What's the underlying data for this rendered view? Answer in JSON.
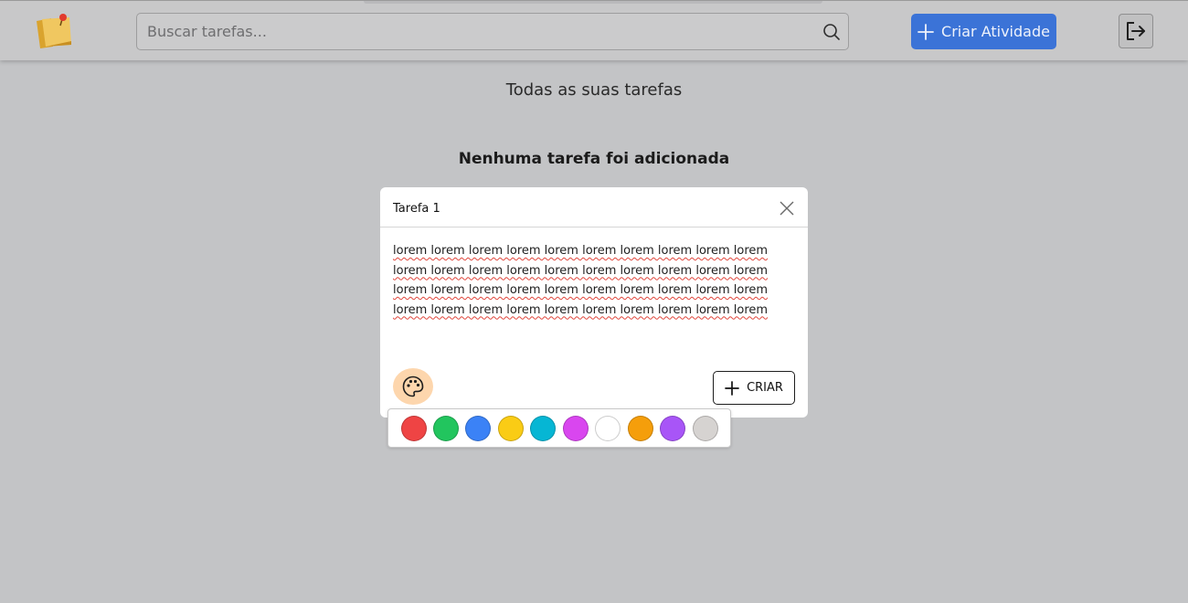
{
  "header": {
    "search_placeholder": "Buscar tarefas...",
    "search_value": "",
    "create_label": "Criar Atividade",
    "logo_icon": "sticky-note-pin-icon",
    "search_icon": "search-icon",
    "create_icon": "plus-icon",
    "logout_icon": "logout-icon"
  },
  "main": {
    "subtitle": "Todas as suas tarefas",
    "empty_message": "Nenhuma tarefa foi adicionada"
  },
  "modal": {
    "title_value": "Tarefa 1",
    "body_text": "lorem lorem lorem lorem lorem lorem lorem lorem lorem lorem\nlorem lorem lorem lorem lorem lorem lorem lorem lorem lorem\nlorem lorem lorem lorem lorem lorem lorem lorem lorem lorem\nlorem lorem lorem lorem lorem lorem lorem lorem lorem lorem",
    "create_label": "CRIAR",
    "close_icon": "close-icon",
    "palette_icon": "palette-icon"
  },
  "colors": {
    "accent": "#3b73d7",
    "palette_button_bg": "#fdd6ad",
    "swatches": [
      "#ef4444",
      "#22c55e",
      "#3b82f6",
      "#facc15",
      "#06b6d4",
      "#d946ef",
      "#ffffff",
      "#f59e0b",
      "#a855f7",
      "#d6d3d1"
    ]
  }
}
